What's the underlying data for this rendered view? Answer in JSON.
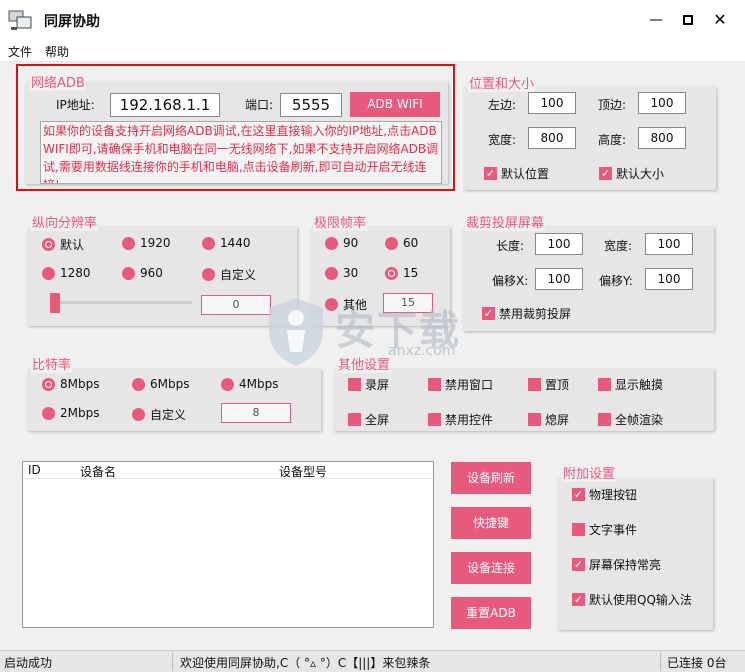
{
  "window": {
    "title": "同屏协助"
  },
  "menu": [
    "文件",
    "帮助"
  ],
  "network_adb": {
    "title": "网络ADB",
    "ip_label": "IP地址:",
    "ip_value": "192.168.1.1",
    "port_label": "端口:",
    "port_value": "5555",
    "button": "ADB WIFI",
    "hint": "如果你的设备支持开启网络ADB调试,在这里直接输入你的IP地址,点击ADB WIFI即可,请确保手机和电脑在同一无线网络下,如果不支持开启网络ADB调试,需要用数据线连接你的手机和电脑,点击设备刷新,即可自动开启无线连接!"
  },
  "position_size": {
    "title": "位置和大小",
    "left_label": "左边:",
    "left_value": "100",
    "top_label": "顶边:",
    "top_value": "100",
    "width_label": "宽度:",
    "width_value": "800",
    "height_label": "高度:",
    "height_value": "800",
    "default_pos": "默认位置",
    "default_size": "默认大小"
  },
  "resolution": {
    "title": "纵向分辨率",
    "options": [
      "默认",
      "1920",
      "1440",
      "1280",
      "960",
      "自定义"
    ],
    "selected": "默认",
    "slider_value": "0"
  },
  "fps": {
    "title": "极限帧率",
    "options": [
      "90",
      "60",
      "30",
      "15",
      "其他"
    ],
    "selected": "15",
    "other_value": "15"
  },
  "crop": {
    "title": "裁剪投屏屏幕",
    "length_label": "长度:",
    "length_value": "100",
    "width_label": "宽度:",
    "width_value": "100",
    "offx_label": "偏移X:",
    "offx_value": "100",
    "offy_label": "偏移Y:",
    "offy_value": "100",
    "disable_crop": "禁用裁剪投屏"
  },
  "bitrate": {
    "title": "比特率",
    "options": [
      "8Mbps",
      "6Mbps",
      "4Mbps",
      "2Mbps",
      "自定义"
    ],
    "selected": "8Mbps",
    "custom_value": "8"
  },
  "other": {
    "title": "其他设置",
    "options": [
      "录屏",
      "禁用窗口",
      "置顶",
      "显示触摸",
      "全屏",
      "禁用控件",
      "熄屏",
      "全帧渲染"
    ]
  },
  "devices": {
    "columns": [
      "ID",
      "设备名",
      "设备型号"
    ]
  },
  "buttons": [
    "设备刷新",
    "快捷键",
    "设备连接",
    "重置ADB"
  ],
  "extra": {
    "title": "附加设置",
    "options": [
      "物理按钮",
      "文字事件",
      "屏幕保持常亮",
      "默认使用QQ输入法"
    ],
    "checked": [
      true,
      false,
      true,
      true
    ]
  },
  "status": {
    "left": "启动成功",
    "middle": "欢迎使用同屏协助,C（ °▵ °）C【|||】来包辣条",
    "right": "已连接 0台"
  },
  "watermark": "安下载",
  "watermark_sub": "anxz.com",
  "colors": {
    "accent": "#e85a7d",
    "highlight_box": "#e01010"
  }
}
